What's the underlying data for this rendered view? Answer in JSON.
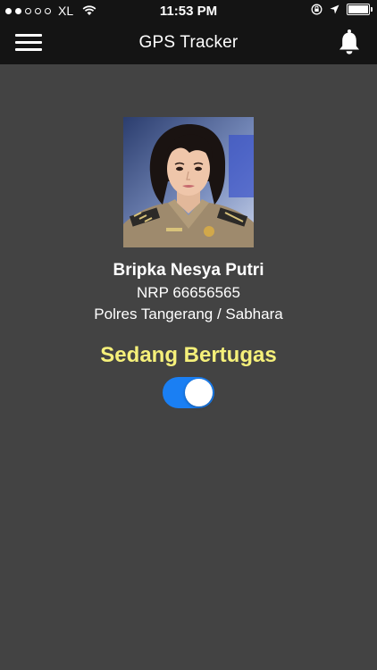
{
  "status_bar": {
    "carrier": "XL",
    "time": "11:53 PM"
  },
  "nav": {
    "title": "GPS Tracker",
    "menu_icon": "hamburger-menu-icon",
    "bell_icon": "bell-icon"
  },
  "profile": {
    "name": "Bripka Nesya Putri",
    "nrp": "NRP 66656565",
    "unit": "Polres Tangerang / Sabhara"
  },
  "duty": {
    "label": "Sedang Bertugas",
    "toggle_on": true,
    "toggle_color": "#1a7ff3",
    "label_color": "#f5f07a"
  }
}
